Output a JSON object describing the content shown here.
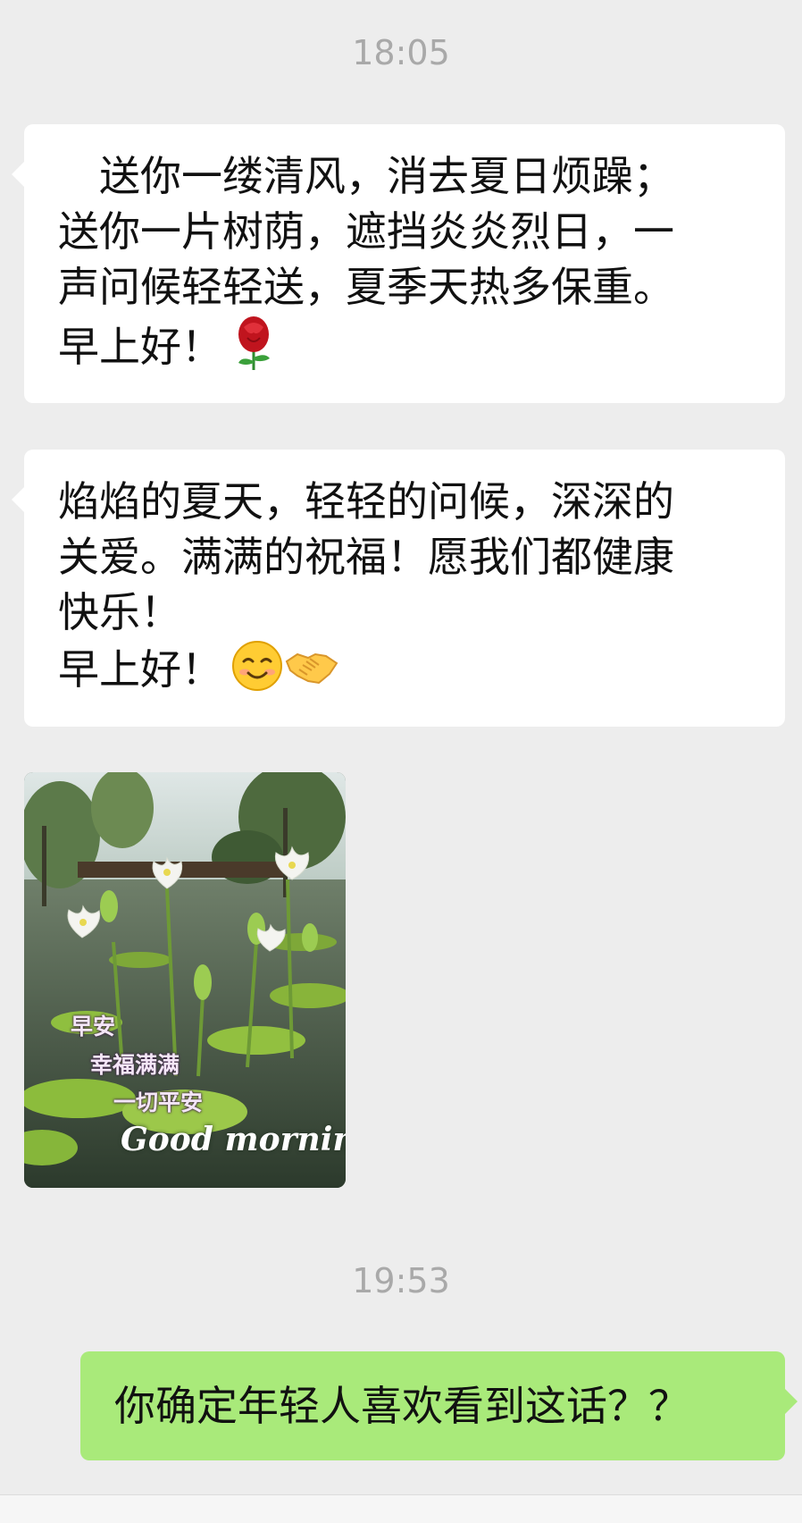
{
  "timestamps": {
    "first": "18:05",
    "second": "19:53"
  },
  "messages": [
    {
      "direction": "incoming",
      "lines": [
        "　送你一缕清风，消去夏日烦躁；",
        "送你一片树荫，遮挡炎炎烈日，一",
        "声问候轻轻送，夏季天热多保重。",
        "早上好！"
      ],
      "emoji": [
        "rose-icon"
      ]
    },
    {
      "direction": "incoming",
      "lines": [
        "焰焰的夏天，轻轻的问候，深深的",
        "关爱。满满的祝福！愿我们都健康",
        "快乐！",
        "早上好！"
      ],
      "emoji": [
        "smiling-face-icon",
        "handshake-icon"
      ]
    },
    {
      "direction": "incoming",
      "type": "image",
      "image_captions": [
        "早安",
        "幸福满满",
        "一切平安"
      ],
      "image_title": "Good morning"
    },
    {
      "direction": "outgoing",
      "text": "你确定年轻人喜欢看到这话？？"
    }
  ],
  "colors": {
    "background": "#ededed",
    "incoming_bubble": "#ffffff",
    "outgoing_bubble": "#a9ea7a",
    "timestamp": "#a9a9a9"
  }
}
